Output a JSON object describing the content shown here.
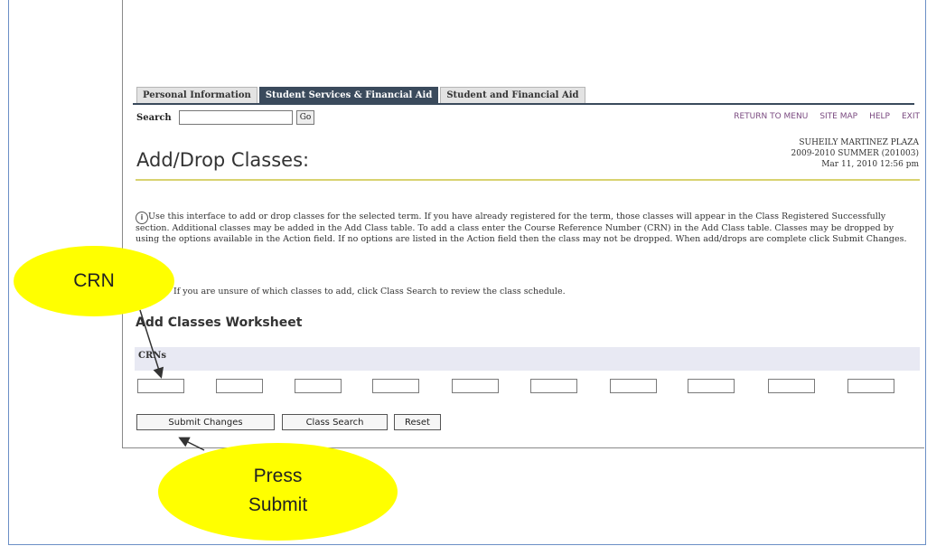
{
  "tabs": [
    {
      "label": "Personal Information",
      "active": false
    },
    {
      "label": "Student Services & Financial Aid",
      "active": true
    },
    {
      "label": "Student and Financial Aid",
      "active": false
    }
  ],
  "search": {
    "label": "Search",
    "placeholder": "",
    "value": "",
    "go_label": "Go"
  },
  "top_links": {
    "return_to_menu": "RETURN TO MENU",
    "site_map": "SITE MAP",
    "help": "HELP",
    "exit": "EXIT"
  },
  "page": {
    "title": "Add/Drop Classes:",
    "user_name": "SUHEILY MARTINEZ PLAZA",
    "term": "2009-2010 SUMMER (201003)",
    "datetime": "Mar 11, 2010 12:56 pm",
    "info_text": "Use this interface to add or drop classes for the selected term. If you have already registered for the term, those classes will appear in the Class Registered Successfully section. Additional classes may be added in the Add Class table. To add a class enter the Course Reference Number (CRN) in the Add Class table. Classes may be dropped by using the options available in the Action field. If no options are listed in the Action field then the class may not be dropped. When add/drops are complete click Submit Changes.",
    "unsure_text": "If you are unsure of which classes to add, click Class Search to review the class schedule.",
    "worksheet_title": "Add Classes Worksheet",
    "crns_label": "CRNs"
  },
  "crn_inputs": [
    "",
    "",
    "",
    "",
    "",
    "",
    "",
    "",
    "",
    ""
  ],
  "buttons": {
    "submit": "Submit Changes",
    "class_search": "Class Search",
    "reset": "Reset"
  },
  "callouts": {
    "crn": "CRN",
    "submit_line1": "Press",
    "submit_line2": "Submit"
  },
  "colors": {
    "callout_fill": "#ffff00",
    "active_tab": "#3a4a5c",
    "link": "#7a4a80",
    "rule": "#d8d270"
  }
}
